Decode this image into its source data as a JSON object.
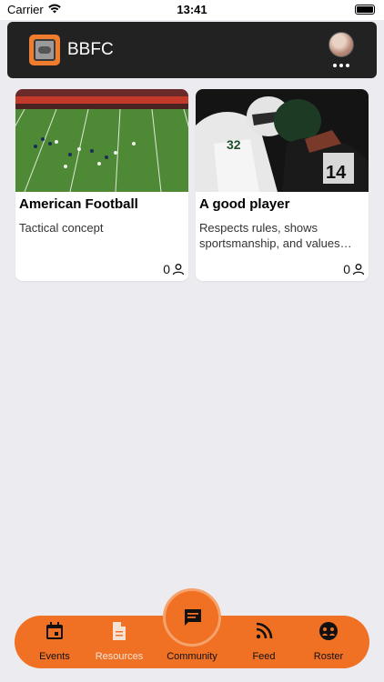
{
  "status_bar": {
    "carrier": "Carrier",
    "time": "13:41"
  },
  "header": {
    "title": "BBFC",
    "logo_icon": "bulldog-logo-icon",
    "avatar_icon": "user-avatar",
    "menu_icon": "more-dots-icon"
  },
  "cards": [
    {
      "title": "American Football",
      "description": "Tactical concept",
      "member_count": "0"
    },
    {
      "title": "A good player",
      "description": "Respects rules, shows sportsmanship, and values teamwork.",
      "member_count": "0"
    }
  ],
  "bottom_nav": {
    "items": [
      {
        "label": "Events",
        "icon": "calendar-icon"
      },
      {
        "label": "Resources",
        "icon": "document-icon"
      },
      {
        "label": "Community",
        "icon": "chat-icon"
      },
      {
        "label": "Feed",
        "icon": "rss-icon"
      },
      {
        "label": "Roster",
        "icon": "team-icon"
      }
    ],
    "active": "Community"
  },
  "colors": {
    "accent": "#f07024",
    "header_bg": "#222222",
    "page_bg": "#ececf0"
  }
}
